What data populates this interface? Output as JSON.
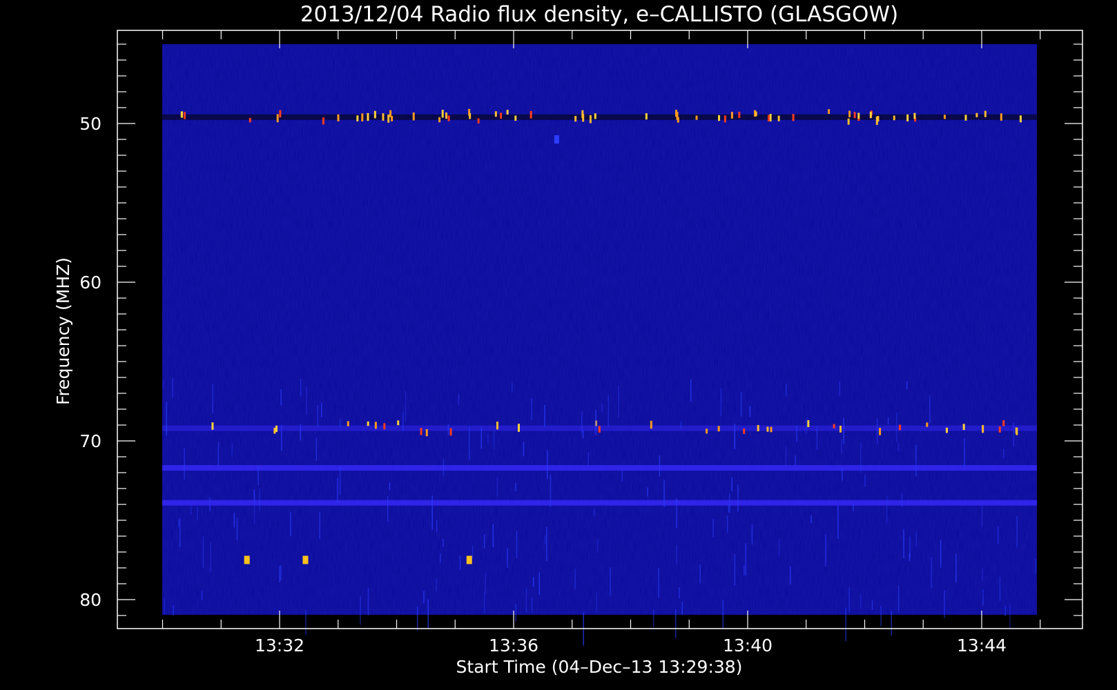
{
  "chart_data": {
    "type": "heatmap",
    "title": "2013/12/04  Radio flux density, e–CALLISTO (GLASGOW)",
    "xlabel": "Start Time (04–Dec–13 13:29:38)",
    "ylabel": "Frequency (MHZ)",
    "x_ticks": [
      "13:32",
      "13:36",
      "13:40",
      "13:44"
    ],
    "x_tick_minutes": [
      2.37,
      6.37,
      10.37,
      14.37
    ],
    "y_ticks": [
      50,
      60,
      70,
      80
    ],
    "ylim": [
      81,
      45
    ],
    "x_data_range_minutes": [
      0.0,
      14.95
    ],
    "colormap": "blue-red-yellow",
    "background_color": "#0c0c9a",
    "features": [
      {
        "kind": "persistent_band",
        "freq_mhz": 49.6,
        "intensity": "high",
        "note": "intermittent bright bursts along band"
      },
      {
        "kind": "persistent_band",
        "freq_mhz": 69.2,
        "intensity": "medium"
      },
      {
        "kind": "persistent_band",
        "freq_mhz": 71.7,
        "intensity": "low"
      },
      {
        "kind": "persistent_band",
        "freq_mhz": 73.9,
        "intensity": "low"
      },
      {
        "kind": "spot",
        "freq_mhz": 51.0,
        "t_min": 7.1,
        "intensity": "low"
      },
      {
        "kind": "spot",
        "freq_mhz": 77.5,
        "t_min": 1.8,
        "intensity": "high"
      },
      {
        "kind": "spot",
        "freq_mhz": 77.5,
        "t_min": 2.8,
        "intensity": "high"
      },
      {
        "kind": "spot",
        "freq_mhz": 77.5,
        "t_min": 5.6,
        "intensity": "high"
      }
    ],
    "legend": "none",
    "grid": false
  }
}
